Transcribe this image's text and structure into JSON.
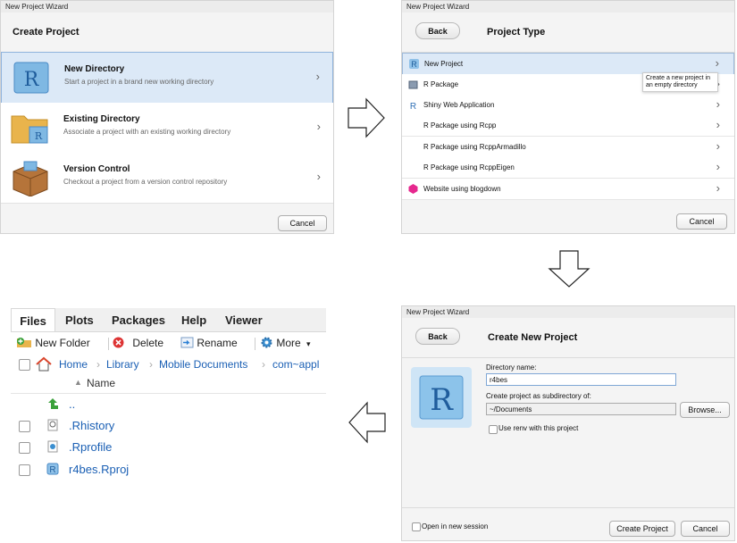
{
  "wizard1": {
    "title": "New Project Wizard",
    "header": "Create Project",
    "items": [
      {
        "title": "New Directory",
        "subtitle": "Start a project in a brand new working directory"
      },
      {
        "title": "Existing Directory",
        "subtitle": "Associate a project with an existing working directory"
      },
      {
        "title": "Version Control",
        "subtitle": "Checkout a project from a version control repository"
      }
    ],
    "cancel": "Cancel"
  },
  "wizard2": {
    "title": "New Project Wizard",
    "back": "Back",
    "header": "Project Type",
    "items": [
      {
        "label": "New Project"
      },
      {
        "label": "R Package"
      },
      {
        "label": "Shiny Web Application"
      },
      {
        "label": "R Package using Rcpp"
      },
      {
        "label": "R Package using RcppArmadillo"
      },
      {
        "label": "R Package using RcppEigen"
      },
      {
        "label": "Website using blogdown"
      }
    ],
    "tooltip": "Create a new project in an empty directory",
    "cancel": "Cancel"
  },
  "wizard3": {
    "title": "New Project Wizard",
    "back": "Back",
    "header": "Create New Project",
    "dir_label": "Directory name:",
    "dir_value": "r4bes",
    "subdir_label": "Create project as subdirectory of:",
    "subdir_value": "~/Documents",
    "browse": "Browse...",
    "renv": "Use renv with this project",
    "open_new": "Open in new session",
    "create": "Create Project",
    "cancel": "Cancel"
  },
  "files": {
    "tabs": [
      "Files",
      "Plots",
      "Packages",
      "Help",
      "Viewer"
    ],
    "toolbar": {
      "new_folder": "New Folder",
      "delete": "Delete",
      "rename": "Rename",
      "more": "More"
    },
    "breadcrumb": [
      "Home",
      "Library",
      "Mobile Documents",
      "com~appl"
    ],
    "col_name": "Name",
    "up": "..",
    "rows": [
      ".Rhistory",
      ".Rprofile",
      "r4bes.Rproj"
    ]
  },
  "colors": {
    "accent": "#1a5fb4",
    "selection": "#dce9f7",
    "r_blue": "#2f6fb5"
  }
}
